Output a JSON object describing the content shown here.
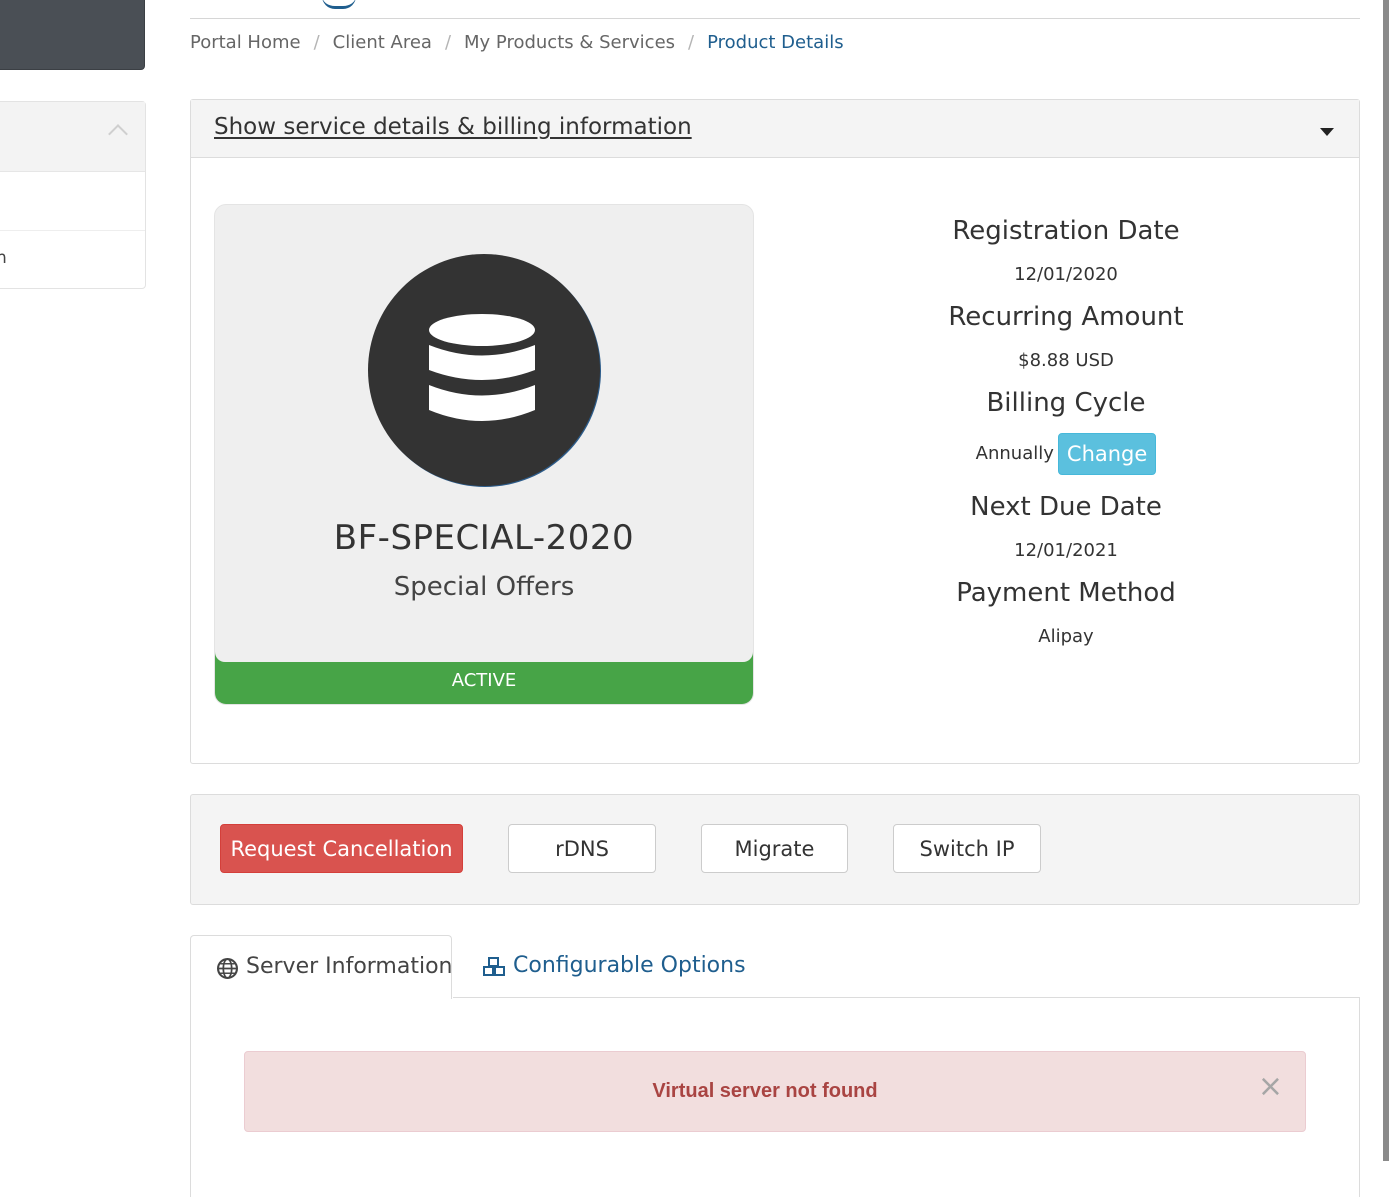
{
  "breadcrumb": {
    "items": [
      "Portal Home",
      "Client Area",
      "My Products & Services"
    ],
    "active": "Product Details",
    "separator": "/"
  },
  "sidebar": {
    "partial_item_text": "n"
  },
  "service_panel": {
    "toggle_label": "Show service details & billing information",
    "product_name": "BF-SPECIAL-2020",
    "product_group": "Special Offers",
    "status": "ACTIVE",
    "icon": "database-icon",
    "details": {
      "registration_date_label": "Registration Date",
      "registration_date": "12/01/2020",
      "recurring_amount_label": "Recurring Amount",
      "recurring_amount": "$8.88 USD",
      "billing_cycle_label": "Billing Cycle",
      "billing_cycle": "Annually",
      "change_label": "Change",
      "next_due_date_label": "Next Due Date",
      "next_due_date": "12/01/2021",
      "payment_method_label": "Payment Method",
      "payment_method": "Alipay"
    }
  },
  "actions": {
    "request_cancellation": "Request Cancellation",
    "rdns": "rDNS",
    "migrate": "Migrate",
    "switch_ip": "Switch IP"
  },
  "tabs": {
    "server_information": "Server Information",
    "configurable_options": "Configurable Options"
  },
  "alert": {
    "message": "Virtual server not found",
    "close": "×"
  },
  "colors": {
    "link": "#1f5e8e",
    "status_active": "#47a447",
    "danger": "#d9534f",
    "info": "#5bc0de",
    "alert_text": "#a94442"
  }
}
